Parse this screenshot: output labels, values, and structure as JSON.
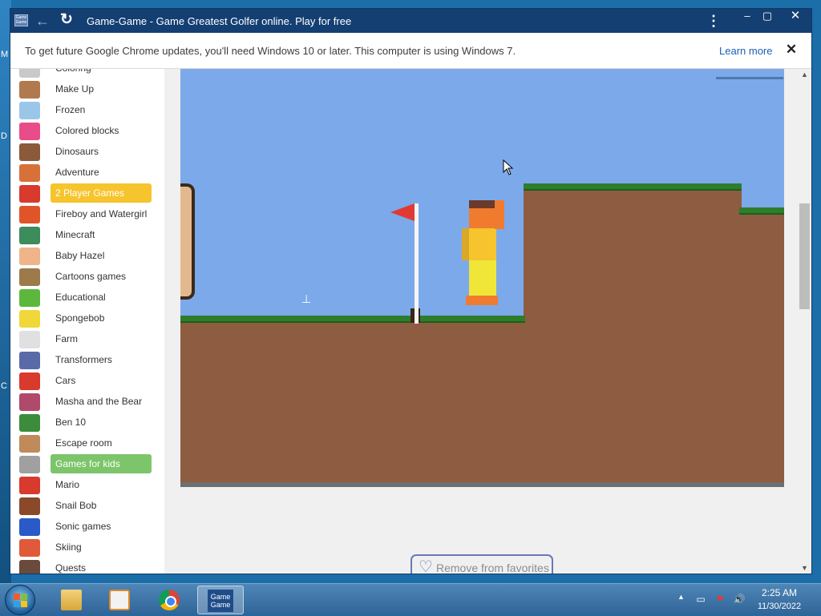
{
  "desktop": {
    "letters": [
      "M",
      "D",
      "C"
    ]
  },
  "browser": {
    "title": "Game-Game - Game Greatest Golfer online. Play for free",
    "app_icon_text": "Game Game",
    "icons": {
      "back": "back-arrow-icon",
      "reload": "reload-icon",
      "menu": "kebab-menu-icon",
      "minimize": "minimize-icon",
      "maximize": "maximize-icon",
      "close": "close-icon"
    },
    "colors": {
      "titlebar": "#143f73",
      "accent": "#1a5fb4"
    }
  },
  "notice": {
    "message": "To get future Google Chrome updates, you'll need Windows 10 or later. This computer is using Windows 7.",
    "link": "Learn more",
    "close_icon": "close-icon"
  },
  "sidebar": {
    "items": [
      {
        "label": "Coloring",
        "icon": "coloring-icon",
        "color": "#c9c9c9"
      },
      {
        "label": "Make Up",
        "icon": "makeup-icon",
        "color": "#b07a4e"
      },
      {
        "label": "Frozen",
        "icon": "frozen-icon",
        "color": "#9cc6e8"
      },
      {
        "label": "Colored blocks",
        "icon": "colored-blocks-icon",
        "color": "#e84d8a"
      },
      {
        "label": "Dinosaurs",
        "icon": "dinosaur-icon",
        "color": "#8a5a3a"
      },
      {
        "label": "Adventure",
        "icon": "adventure-icon",
        "color": "#d8703a"
      },
      {
        "label": "2 Player Games",
        "icon": "two-player-icon",
        "color": "#d83a2e",
        "highlight": "yellow"
      },
      {
        "label": "Fireboy and Watergirl",
        "icon": "fireboy-icon",
        "color": "#e0542a"
      },
      {
        "label": "Minecraft",
        "icon": "minecraft-icon",
        "color": "#3c8c5c"
      },
      {
        "label": "Baby Hazel",
        "icon": "baby-hazel-icon",
        "color": "#f0b48a"
      },
      {
        "label": "Cartoons games",
        "icon": "cartoons-icon",
        "color": "#9c7a4a"
      },
      {
        "label": "Educational",
        "icon": "educational-icon",
        "color": "#5cb83c"
      },
      {
        "label": "Spongebob",
        "icon": "spongebob-icon",
        "color": "#f0d83a"
      },
      {
        "label": "Farm",
        "icon": "farm-icon",
        "color": "#e0e0e0"
      },
      {
        "label": "Transformers",
        "icon": "transformers-icon",
        "color": "#5a6aa8"
      },
      {
        "label": "Cars",
        "icon": "cars-icon",
        "color": "#d83a2e"
      },
      {
        "label": "Masha and the Bear",
        "icon": "masha-icon",
        "color": "#b04a6a"
      },
      {
        "label": "Ben 10",
        "icon": "ben10-icon",
        "color": "#3c8c3c"
      },
      {
        "label": "Escape room",
        "icon": "escape-room-icon",
        "color": "#c08a5a"
      },
      {
        "label": "Games for kids",
        "icon": "kids-icon",
        "color": "#a0a0a0",
        "highlight": "green"
      },
      {
        "label": "Mario",
        "icon": "mario-icon",
        "color": "#d83a2e"
      },
      {
        "label": "Snail Bob",
        "icon": "snail-bob-icon",
        "color": "#8a4a2a"
      },
      {
        "label": "Sonic games",
        "icon": "sonic-icon",
        "color": "#2a5ac8"
      },
      {
        "label": "Skiing",
        "icon": "skiing-icon",
        "color": "#e05a3a"
      },
      {
        "label": "Quests",
        "icon": "quests-icon",
        "color": "#6a4a3a"
      }
    ]
  },
  "game": {
    "name": "Greatest Golfer",
    "colors": {
      "sky": "#7ca9ea",
      "dirt": "#8e5c40",
      "grass": "#2e7d2a",
      "flag": "#e23a33"
    }
  },
  "favorites": {
    "label": "Remove from favorites",
    "icon": "heart-plus-icon"
  },
  "taskbar": {
    "apps": [
      {
        "name": "explorer-icon",
        "active": false
      },
      {
        "name": "media-player-icon",
        "active": false
      },
      {
        "name": "chrome-icon",
        "active": false
      },
      {
        "name": "game-game-icon",
        "active": true,
        "text": "Game Game"
      }
    ],
    "tray_icons": [
      "show-hidden-icons-icon",
      "network-icon",
      "action-center-icon",
      "volume-icon"
    ],
    "time": "2:25 AM",
    "date": "11/30/2022"
  }
}
